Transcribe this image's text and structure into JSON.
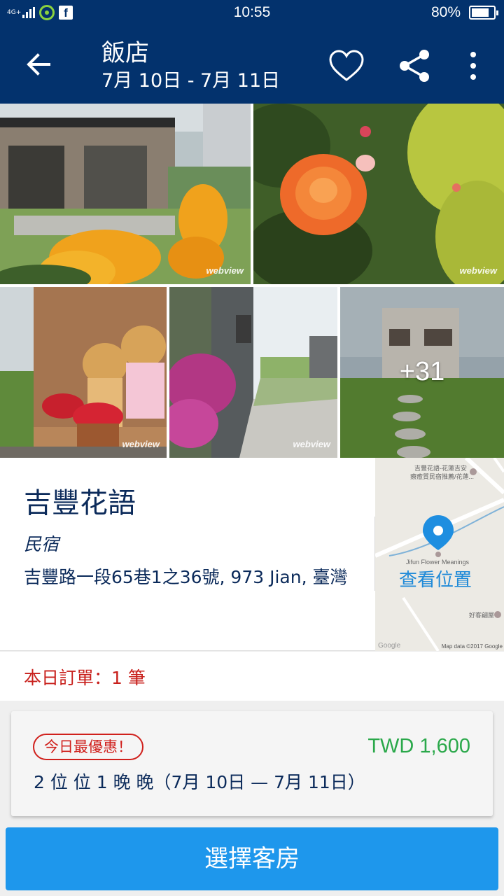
{
  "status_bar": {
    "network": "4G+",
    "time": "10:55",
    "battery_percent": "80%",
    "battery_level": 0.8
  },
  "app_bar": {
    "title": "飯店",
    "dates": "7月 10日 - 7月 11日",
    "icons": [
      "back-arrow-icon",
      "heart-icon",
      "share-icon",
      "more-vert-icon"
    ]
  },
  "gallery": {
    "watermark": "webview",
    "more_photos": "+31"
  },
  "hotel": {
    "name": "吉豐花語",
    "type": "民宿",
    "address": "吉豐路一段65巷1之36號, 973 Jian, 臺灣"
  },
  "map": {
    "link": "查看位置",
    "label_top": "吉豐花語-花蓮吉安",
    "label_top2": "療癒質民宿推薦/花蓮...",
    "label_place": "Jifun Flower Meanings",
    "label_other": "好客翩屋",
    "copyright": "Map data ©2017 Google",
    "google": "Google"
  },
  "orders": {
    "text": "本日訂單：1 筆"
  },
  "offer": {
    "badge": "今日最優惠！",
    "price": "TWD 1,600",
    "detail": "2 位 位 1 晚 晚（7月 10日 — 7月 11日）"
  },
  "cta": {
    "label": "選擇客房"
  },
  "colors": {
    "header_bg": "#03326d",
    "accent_blue": "#1e97ec",
    "price_green": "#2aa84a",
    "alert_red": "#c8201c",
    "text_navy": "#0b2a5a"
  }
}
